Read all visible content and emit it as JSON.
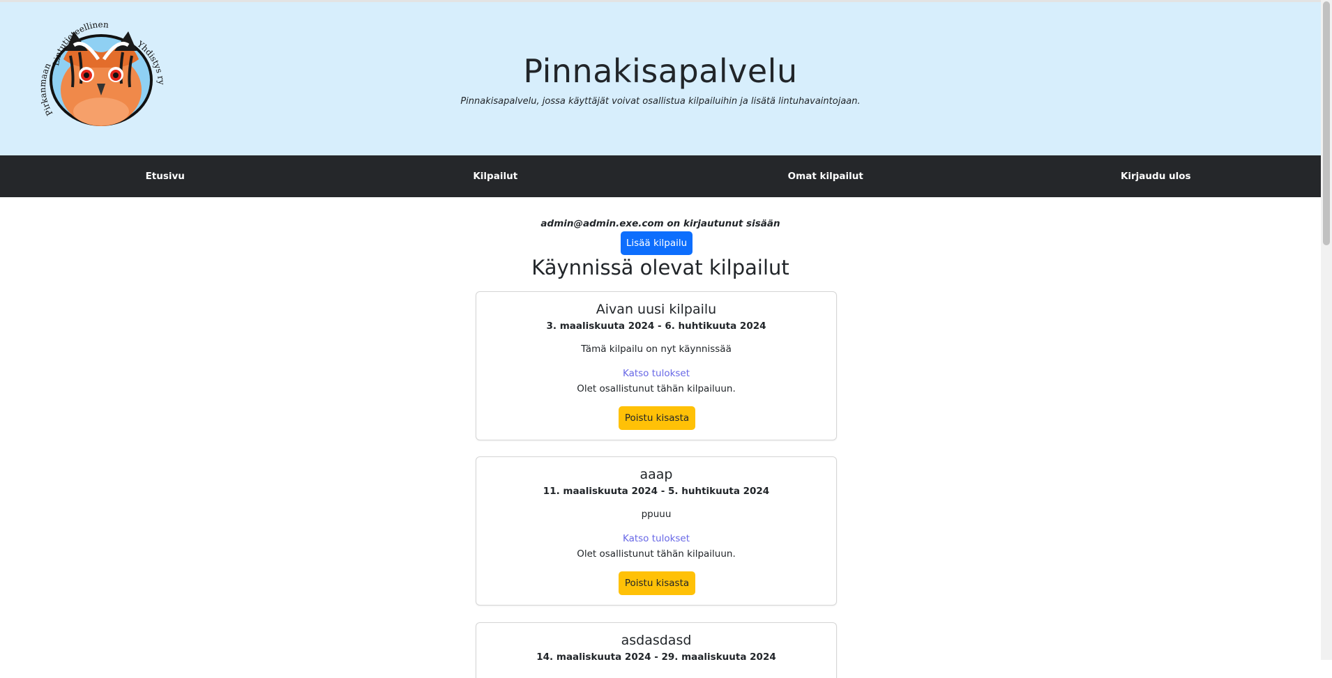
{
  "header": {
    "title": "Pinnakisapalvelu",
    "subtitle": "Pinnakisapalvelu, jossa käyttäjät voivat osallistua kilpailuihin ja lisätä lintuhavaintojaan.",
    "logo_text_top": "Lintutieteellinen",
    "logo_text_left": "Pirkanmaan",
    "logo_text_right": "Yhdistys ry",
    "logo_icon": "owl-logo"
  },
  "nav": {
    "items": [
      {
        "label": "Etusivu"
      },
      {
        "label": "Kilpailut"
      },
      {
        "label": "Omat kilpailut"
      },
      {
        "label": "Kirjaudu ulos"
      }
    ]
  },
  "main": {
    "login_status": "admin@admin.exe.com on kirjautunut sisään",
    "add_button": "Lisää kilpailu",
    "section_title": "Käynnissä olevat kilpailut",
    "cards": [
      {
        "title": "Aivan uusi kilpailu",
        "dates": "3. maaliskuuta 2024 - 6. huhtikuuta 2024",
        "description": "Tämä kilpailu on nyt käynnissää",
        "link": "Katso tulokset",
        "status": "Olet osallistunut tähän kilpailuun.",
        "button": "Poistu kisasta"
      },
      {
        "title": "aaap",
        "dates": "11. maaliskuuta 2024 - 5. huhtikuuta 2024",
        "description": "ppuuu",
        "link": "Katso tulokset",
        "status": "Olet osallistunut tähän kilpailuun.",
        "button": "Poistu kisasta"
      },
      {
        "title": "asdasdasd",
        "dates": "14. maaliskuuta 2024 - 29. maaliskuuta 2024",
        "description": "",
        "link": "",
        "status": "",
        "button": ""
      }
    ]
  },
  "colors": {
    "header_bg": "#d7eefc",
    "navbar_bg": "#25272a",
    "primary": "#0d6efd",
    "warning": "#ffc107",
    "link": "#6767e6"
  }
}
